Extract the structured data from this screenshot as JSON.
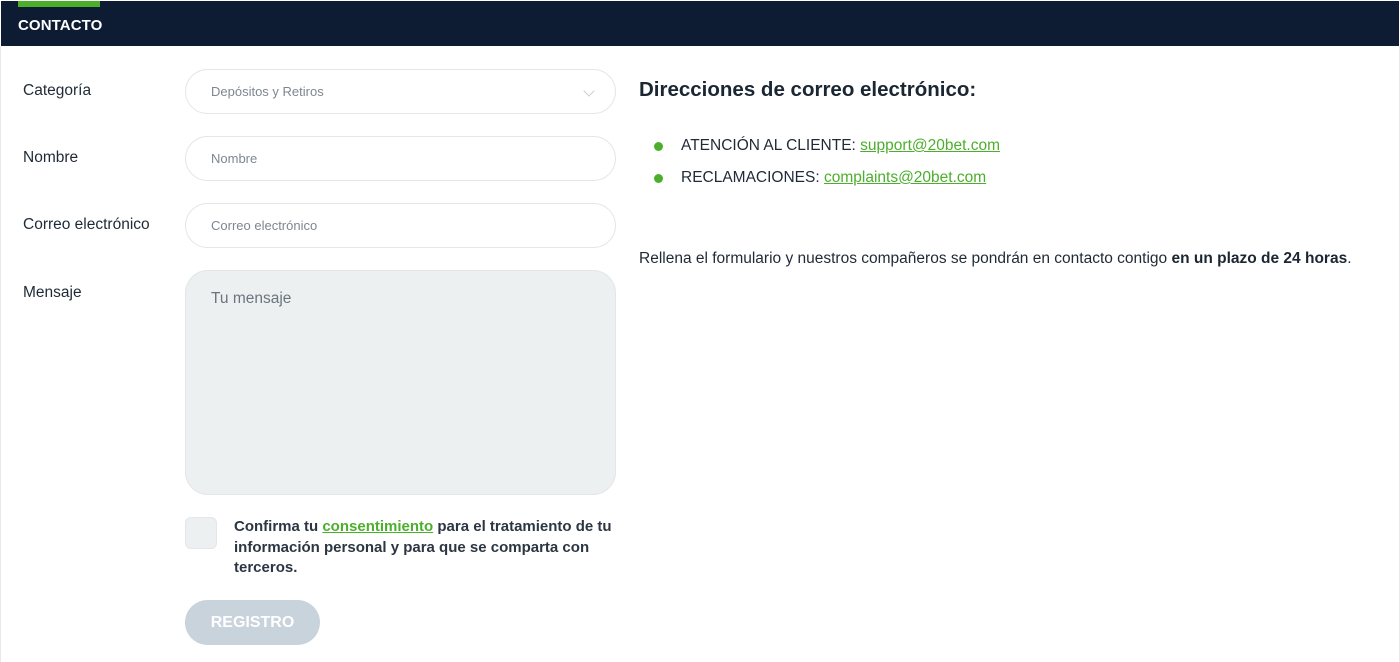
{
  "header": {
    "title": "CONTACTO"
  },
  "form": {
    "category": {
      "label": "Categoría",
      "value": "Depósitos y Retiros"
    },
    "name": {
      "label": "Nombre",
      "placeholder": "Nombre"
    },
    "email": {
      "label": "Correo electrónico",
      "placeholder": "Correo electrónico"
    },
    "message": {
      "label": "Mensaje",
      "placeholder": "Tu mensaje"
    },
    "consent": {
      "prefix": "Confirma tu",
      "link": "consentimiento",
      "suffix": "para el tratamiento de tu información personal y para que se comparta con terceros."
    },
    "submit_label": "REGISTRO"
  },
  "emails": {
    "title": "Direcciones de correo electrónico:",
    "items": [
      {
        "label": "ATENCIÓN AL CLIENTE:",
        "address": "support@20bet.com"
      },
      {
        "label": "RECLAMACIONES:",
        "address": "complaints@20bet.com"
      }
    ]
  },
  "note": {
    "text": "Rellena el formulario y nuestros compañeros se pondrán en contacto contigo",
    "bold": "en un plazo de 24 horas",
    "end": "."
  },
  "colors": {
    "header_bg": "#0d1b33",
    "accent": "#4caf2c",
    "button_disabled": "#c9d3dc"
  }
}
